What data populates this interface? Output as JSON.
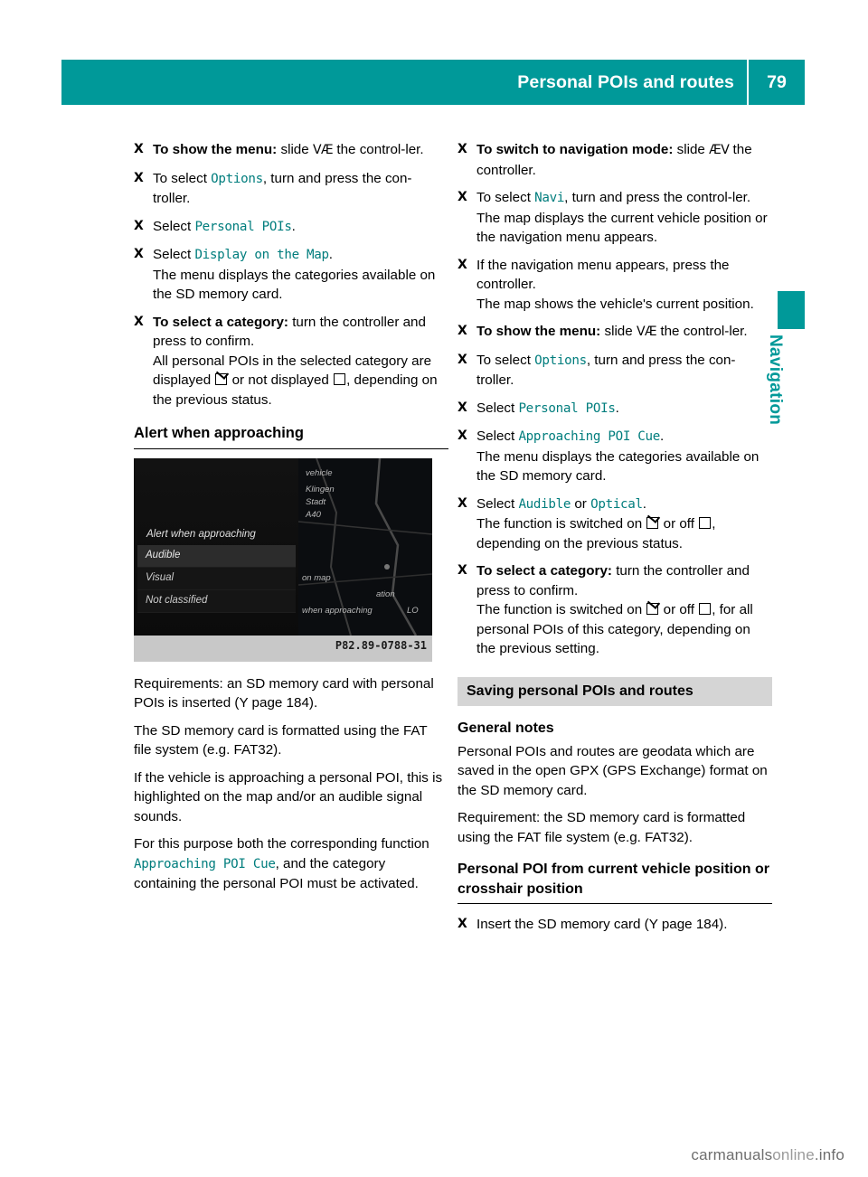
{
  "header": {
    "title": "Personal POIs and routes",
    "page_number": "79"
  },
  "side_tab": {
    "label": "Navigation"
  },
  "left_column": {
    "steps": [
      {
        "bullet": "X",
        "lead": "To show the menu:",
        "text": " slide ",
        "glyph": "VÆ",
        "tail": " the control-ler."
      },
      {
        "bullet": "X",
        "text_a": "To select ",
        "mono": "Options",
        "text_b": ", turn and press the con-troller."
      },
      {
        "bullet": "X",
        "text_a": "Select ",
        "mono": "Personal POIs",
        "text_b": "."
      },
      {
        "bullet": "X",
        "text_a": "Select ",
        "mono": "Display on the Map",
        "text_b": ".",
        "sub": "The menu displays the categories available on the SD memory card."
      },
      {
        "bullet": "X",
        "lead": "To select a category:",
        "text": " turn the controller and press to confirm.",
        "sub_a": "All personal POIs in the selected category are displayed ",
        "sub_b": " or not displayed ",
        "sub_c": ", depending on the previous status."
      }
    ],
    "heading": "Alert when approaching",
    "figure": {
      "title": "Alert when approaching",
      "menu_items": [
        "Audible",
        "Visual",
        "Not classified"
      ],
      "right_labels": [
        "vehicle",
        "Klingen",
        "Stadt",
        "A40",
        "on map",
        "when approaching",
        "ation",
        "LO"
      ],
      "code": "P82.89-0788-31"
    },
    "paragraphs": [
      "Requirements: an SD memory card with personal POIs is inserted (Y page 184).",
      "The SD memory card is formatted using the FAT file system (e.g. FAT32).",
      "If the vehicle is approaching a personal POI, this is highlighted on the map and/or an audible signal sounds."
    ],
    "last_paragraph": {
      "a": "For this purpose both the corresponding function ",
      "mono": "Approaching POI Cue",
      "b": ", and the category containing the personal POI must be activated."
    }
  },
  "right_column": {
    "steps": [
      {
        "bullet": "X",
        "lead": "To switch to navigation mode:",
        "text": " slide ",
        "glyph": "ÆV",
        "tail": " the controller."
      },
      {
        "bullet": "X",
        "text_a": "To select ",
        "mono": "Navi",
        "text_b": ", turn and press the control-ler.",
        "sub": "The map displays the current vehicle position or the navigation menu appears."
      },
      {
        "bullet": "X",
        "text": "If the navigation menu appears, press the controller.",
        "sub": "The map shows the vehicle's current position."
      },
      {
        "bullet": "X",
        "lead": "To show the menu:",
        "text": " slide ",
        "glyph": "VÆ",
        "tail": " the control-ler."
      },
      {
        "bullet": "X",
        "text_a": "To select ",
        "mono": "Options",
        "text_b": ", turn and press the con-troller."
      },
      {
        "bullet": "X",
        "text_a": "Select ",
        "mono": "Personal POIs",
        "text_b": "."
      },
      {
        "bullet": "X",
        "text_a": "Select ",
        "mono": "Approaching POI Cue",
        "text_b": ".",
        "sub": "The menu displays the categories available on the SD memory card."
      },
      {
        "bullet": "X",
        "text_a": "Select ",
        "mono": "Audible",
        "text_mid": " or ",
        "mono2": "Optical",
        "text_b": ".",
        "sub_a": "The function is switched on ",
        "sub_b": " or off ",
        "sub_c": ", depending on the previous status."
      },
      {
        "bullet": "X",
        "lead": "To select a category:",
        "text": " turn the controller and press to confirm.",
        "sub_a": "The function is switched on ",
        "sub_b": " or off ",
        "sub_c": ", for all personal POIs of this category, depending on the previous setting."
      }
    ],
    "section_band": "Saving personal POIs and routes",
    "h_general": "General notes",
    "general_p1": {
      "a": "Personal POIs and routes are geodata which are saved in the open GPX (",
      "b_bold": "GP",
      "c": "S Ex",
      "d_bold": "",
      "e": "change) format on the SD memory card."
    },
    "general_p1_plain": "Personal POIs and routes are geodata which are saved in the open GPX (GPS Exchange) format on the SD memory card.",
    "general_p2": "Requirement: the SD memory card is formatted using the FAT file system (e.g. FAT32).",
    "h_poi": "Personal POI from current vehicle position or crosshair position",
    "last_step": {
      "bullet": "X",
      "text": "Insert the SD memory card (Y page 184)."
    }
  },
  "watermark": {
    "text_a": "carmanuals",
    "text_b": "online",
    "text_c": ".info"
  }
}
